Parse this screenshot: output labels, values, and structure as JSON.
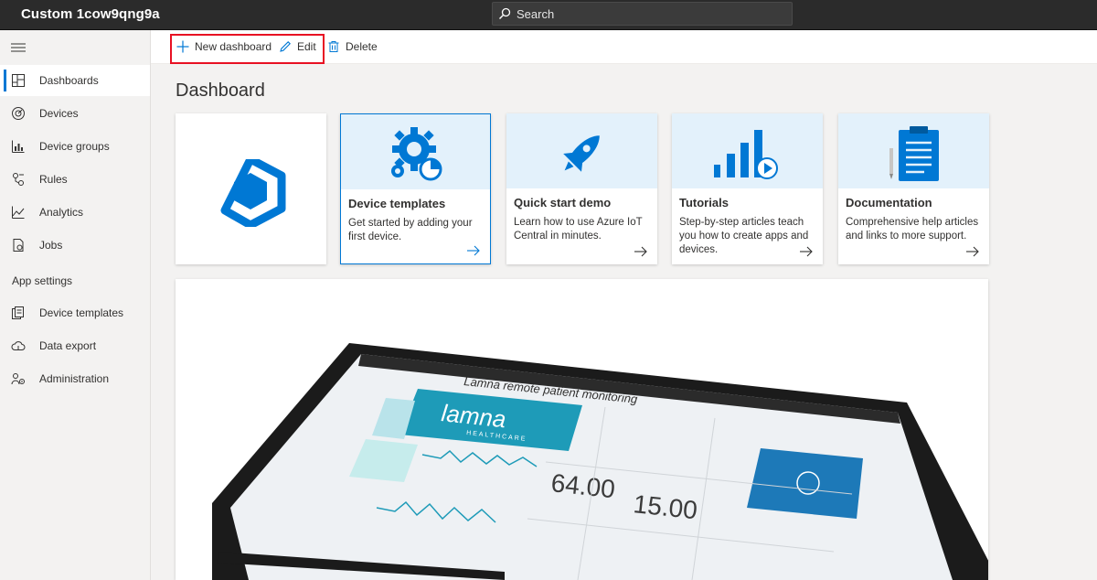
{
  "app": {
    "title": "Custom 1cow9qng9a"
  },
  "search": {
    "placeholder": "Search"
  },
  "sidebar": {
    "items": [
      {
        "label": "Dashboards"
      },
      {
        "label": "Devices"
      },
      {
        "label": "Device groups"
      },
      {
        "label": "Rules"
      },
      {
        "label": "Analytics"
      },
      {
        "label": "Jobs"
      }
    ],
    "section_label": "App settings",
    "settings_items": [
      {
        "label": "Device templates"
      },
      {
        "label": "Data export"
      },
      {
        "label": "Administration"
      }
    ]
  },
  "toolbar": {
    "new_dashboard_label": "New dashboard",
    "edit_label": "Edit",
    "delete_label": "Delete"
  },
  "page": {
    "title": "Dashboard"
  },
  "cards": [
    {
      "title": "Device templates",
      "description": "Get started by adding your first device."
    },
    {
      "title": "Quick start demo",
      "description": "Learn how to use Azure IoT Central in minutes."
    },
    {
      "title": "Tutorials",
      "description": "Step-by-step articles teach you how to create apps and devices."
    },
    {
      "title": "Documentation",
      "description": "Comprehensive help articles and links to more support."
    }
  ],
  "hero": {
    "screen_title": "Lamna remote patient monitoring",
    "brand": "lamna",
    "brand_sub": "HEALTHCARE",
    "reading_1": "64.00",
    "reading_2": "15.00"
  },
  "colors": {
    "accent": "#0078d4",
    "highlight": "#e81123",
    "topbar": "#2b2b2b"
  }
}
